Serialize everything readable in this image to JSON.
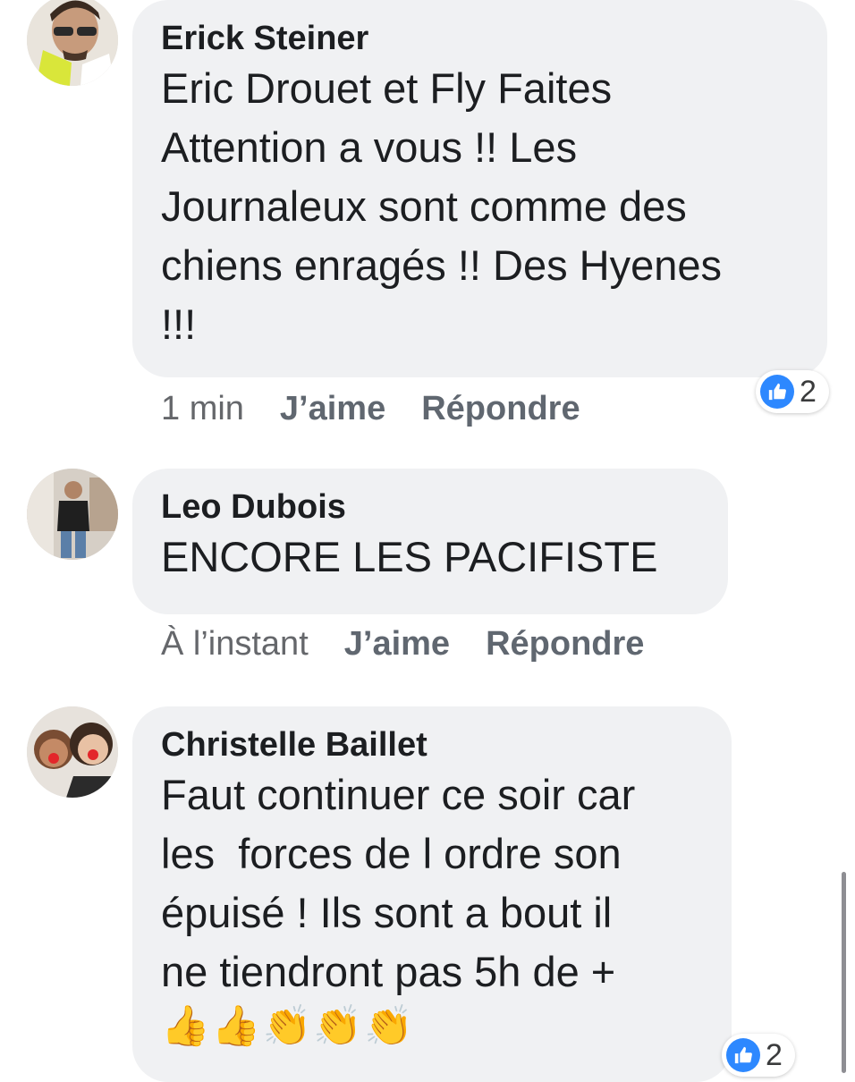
{
  "comments": [
    {
      "author": "Erick Steiner",
      "text": "Eric Drouet et Fly Faites\nAttention a vous !! Les\nJournaleux sont comme des\nchiens enragés !! Des Hyenes\n!!!",
      "time": "1 min",
      "like_label": "J’aime",
      "reply_label": "Répondre",
      "reaction_count": "2",
      "reaction_icon": "like-icon"
    },
    {
      "author": "Leo Dubois",
      "text": "ENCORE LES PACIFISTE",
      "time": "À l’instant",
      "like_label": "J’aime",
      "reply_label": "Répondre"
    },
    {
      "author": "Christelle Baillet",
      "text": "Faut continuer ce soir car\nles  forces de l ordre son\népuisé ! Ils sont a bout il\nne tiendront pas 5h de +",
      "emojis": "👍👍👏👏👏",
      "reaction_count": "2",
      "reaction_icon": "like-icon"
    }
  ],
  "colors": {
    "bubble": "#f0f1f3",
    "like_blue": "#2d88ff",
    "meta_text": "#65676b"
  }
}
